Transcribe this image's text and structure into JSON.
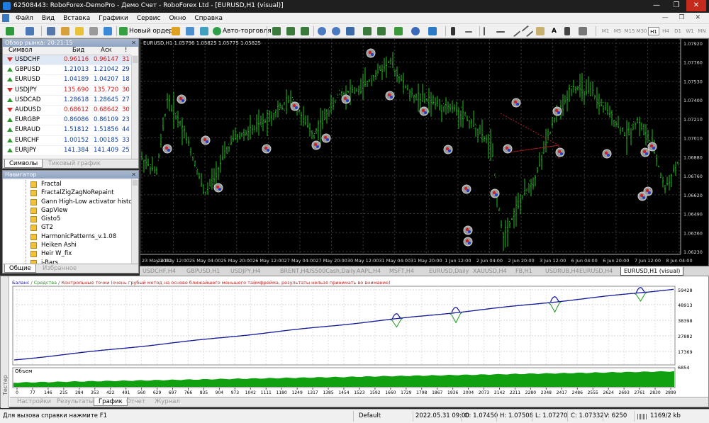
{
  "window": {
    "title": "62508443: RoboForex-DemoPro - Демо Счет - RoboForex Ltd - [EURUSD,H1 (visual)]",
    "minimize": "—",
    "maximize": "❐",
    "close": "✕"
  },
  "menu": [
    "Файл",
    "Вид",
    "Вставка",
    "Графики",
    "Сервис",
    "Окно",
    "Справка"
  ],
  "toolbar": {
    "new_order": "Новый ордер",
    "autotrading": "Авто-торговля",
    "timeframes": [
      "M1",
      "M5",
      "M15",
      "M30",
      "H1",
      "H4",
      "D1",
      "W1",
      "MN"
    ],
    "text_tool": "A",
    "text_label_tool": "T"
  },
  "market_watch": {
    "title": "Обзор рынка: 20:21:15",
    "col_symbol": "Символ",
    "col_bid": "Бид",
    "col_ask": "Аск",
    "col_spread": "!",
    "rows": [
      {
        "symbol": "USDCHF",
        "bid": "0.96116",
        "ask": "0.96147",
        "spread": "31",
        "dir": "down"
      },
      {
        "symbol": "GBPUSD",
        "bid": "1.21013",
        "ask": "1.21042",
        "spread": "29",
        "dir": "up"
      },
      {
        "symbol": "EURUSD",
        "bid": "1.04189",
        "ask": "1.04207",
        "spread": "18",
        "dir": "up"
      },
      {
        "symbol": "USDJPY",
        "bid": "135.690",
        "ask": "135.720",
        "spread": "30",
        "dir": "down"
      },
      {
        "symbol": "USDCAD",
        "bid": "1.28618",
        "ask": "1.28645",
        "spread": "27",
        "dir": "up"
      },
      {
        "symbol": "AUDUSD",
        "bid": "0.68612",
        "ask": "0.68642",
        "spread": "30",
        "dir": "down"
      },
      {
        "symbol": "EURGBP",
        "bid": "0.86086",
        "ask": "0.86109",
        "spread": "23",
        "dir": "up"
      },
      {
        "symbol": "EURAUD",
        "bid": "1.51812",
        "ask": "1.51856",
        "spread": "44",
        "dir": "up"
      },
      {
        "symbol": "EURCHF",
        "bid": "1.00152",
        "ask": "1.00185",
        "spread": "33",
        "dir": "up"
      },
      {
        "symbol": "EURJPY",
        "bid": "141.384",
        "ask": "141.409",
        "spread": "25",
        "dir": "up"
      }
    ],
    "tab_symbols": "Символы",
    "tab_tick": "Тиковый график"
  },
  "navigator": {
    "title": "Навигатор",
    "items": [
      "Fractal",
      "FractalZigZagNoRepaint",
      "Gann High-Low activator histo nm",
      "GapView",
      "Gisto5",
      "GT2",
      "HarmonicPatterns_v.1.08",
      "Heiken Ashi",
      "Heir W_fix",
      "i-Bars"
    ],
    "tab_common": "Общие",
    "tab_favorites": "Избранное"
  },
  "chart": {
    "info": "EURUSD,H1  1.05796 1.05825 1.05775 1.05825",
    "price_ticks": [
      "1.07920",
      "1.07760",
      "1.07530",
      "1.07400",
      "1.07210",
      "1.07010",
      "1.06880",
      "1.06760",
      "1.06620",
      "1.06490",
      "1.06360",
      "1.06230"
    ],
    "time_ticks": [
      "23 May 2022",
      "24 May 12:00",
      "25 May 04:00",
      "25 May 20:00",
      "26 May 12:00",
      "27 May 04:00",
      "27 May 20:00",
      "30 May 12:00",
      "31 May 04:00",
      "31 May 20:00",
      "1 Jun 12:00",
      "2 Jun 04:00",
      "2 Jun 20:00",
      "3 Jun 12:00",
      "6 Jun 04:00",
      "6 Jun 20:00",
      "7 Jun 12:00",
      "8 Jun 04:00"
    ],
    "tabs": [
      "USDCHF,H4",
      "GBPUSD,H1",
      "USDJPY,H4",
      "BRENT,H4",
      "US500Cash,Daily",
      "AAPL,H4",
      "MSFT,H4",
      "EURUSD,Daily",
      "XAUUSD,H4",
      "FB,H1",
      "USDRUB,H4",
      "EURUSD,H4",
      "EURUSD,H1 (visual)"
    ],
    "colors": {
      "bars": "#1fbf1f",
      "background": "#000000",
      "grid": "#3a3a3a"
    }
  },
  "tester": {
    "side_label": "Тестер",
    "legend_balance": "Баланс",
    "legend_funds": "Средства",
    "legend_rest": "Контрольные точки (очень грубый метод на основе ближайшего меньшего таймфрейма, результаты нельзя принимать во внимание)",
    "volume_label": "Объем",
    "y_ticks": [
      "59428",
      "48913",
      "38398",
      "27882",
      "17369",
      "6854"
    ],
    "x_ticks": [
      "0",
      "77",
      "146",
      "215",
      "284",
      "353",
      "422",
      "491",
      "560",
      "629",
      "697",
      "766",
      "835",
      "904",
      "973",
      "1042",
      "1111",
      "1180",
      "1249",
      "1317",
      "1385",
      "1454",
      "1523",
      "1592",
      "1660",
      "1729",
      "1798",
      "1867",
      "1936",
      "2004",
      "2073",
      "2142",
      "2211",
      "2280",
      "2348",
      "2417",
      "2486",
      "2555",
      "2624",
      "2693",
      "2761",
      "2830",
      "2899"
    ],
    "tabs": [
      "Настройки",
      "Результаты",
      "График",
      "Отчет",
      "Журнал"
    ],
    "active_tab": "График",
    "balance_color": "#1a1aa0",
    "funds_color": "#1a9a1a"
  },
  "status": {
    "help": "Для вызова справки нажмите F1",
    "profile": "Default",
    "datetime": "2022.05.31 09:00",
    "open": "O: 1.07450",
    "high": "H: 1.07508",
    "low": "L: 1.07270",
    "close": "C: 1.07332",
    "volume": "V: 6250",
    "traffic": "1169/2 kb"
  }
}
